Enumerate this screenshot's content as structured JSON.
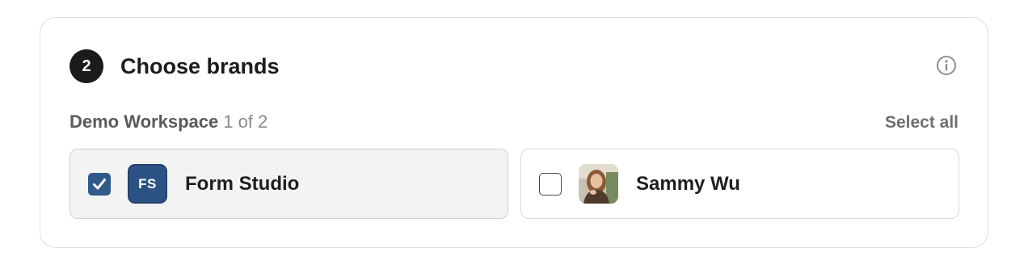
{
  "section": {
    "step_number": "2",
    "title": "Choose brands",
    "info_icon": "info-icon"
  },
  "workspace": {
    "name": "Demo Workspace",
    "count": "1 of 2",
    "select_all_label": "Select all"
  },
  "brands": [
    {
      "name": "Form Studio",
      "initials": "FS",
      "checked": true,
      "avatar_color": "#2c5283"
    },
    {
      "name": "Sammy Wu",
      "checked": false,
      "avatar": "photo-avatar"
    }
  ],
  "colors": {
    "accent": "#2f5a8a",
    "selected_background": "#f3f3f3"
  }
}
